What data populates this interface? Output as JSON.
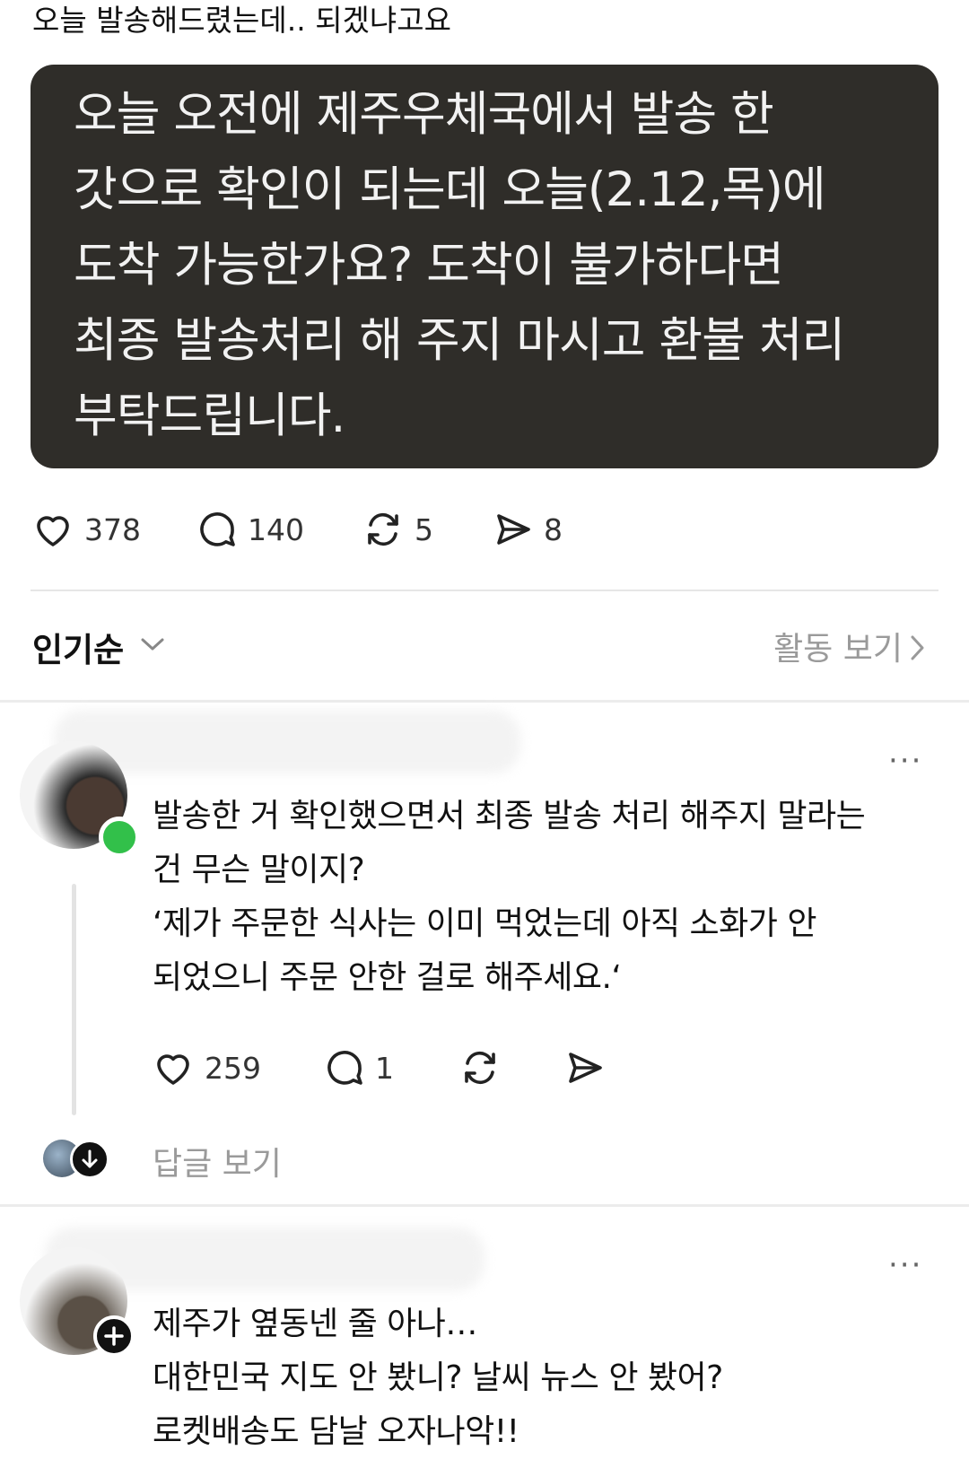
{
  "post": {
    "caption": "오늘 발송해드렸는데.. 되겠냐고요",
    "quote_lines": [
      "오늘 오전에 제주우체국에서 발송 한",
      "갓으로 확인이 되는데 오늘(2.12,목)에",
      "도착 가능한가요? 도착이 불가하다면",
      "최종 발송처리 해 주지 마시고 환불 처리",
      "부탁드립니다."
    ],
    "stats": {
      "likes": "378",
      "comments": "140",
      "reposts": "5",
      "shares": "8"
    }
  },
  "sort": {
    "label": "인기순",
    "activity": "활동 보기"
  },
  "comments": [
    {
      "lines": [
        "발송한 거 확인했으면서 최종 발송 처리 해주지 말라는",
        "건 무슨 말이지?",
        "‘제가 주문한 식사는 이미 먹었는데 아직 소화가 안",
        "되었으니 주문 안한 걸로 해주세요.‘"
      ],
      "likes": "259",
      "replies": "1",
      "reply_link": "답글 보기"
    },
    {
      "lines": [
        "제주가 옆동넨 줄 아나…",
        "대한민국 지도 안 봤니? 날씨 뉴스 안 봤어?",
        "로켓배송도 담날 오자나악!!"
      ]
    }
  ],
  "more_label": "···",
  "icons": [
    "heart-icon",
    "comment-icon",
    "repost-icon",
    "share-icon",
    "chevron-down-icon",
    "chevron-right-icon",
    "more-icon",
    "online-status-icon",
    "reply-arrow-icon",
    "follow-plus-icon"
  ],
  "colors": {
    "quote_bg": "#2f2d29",
    "online": "#32c04a",
    "muted": "#9a9a9a"
  }
}
